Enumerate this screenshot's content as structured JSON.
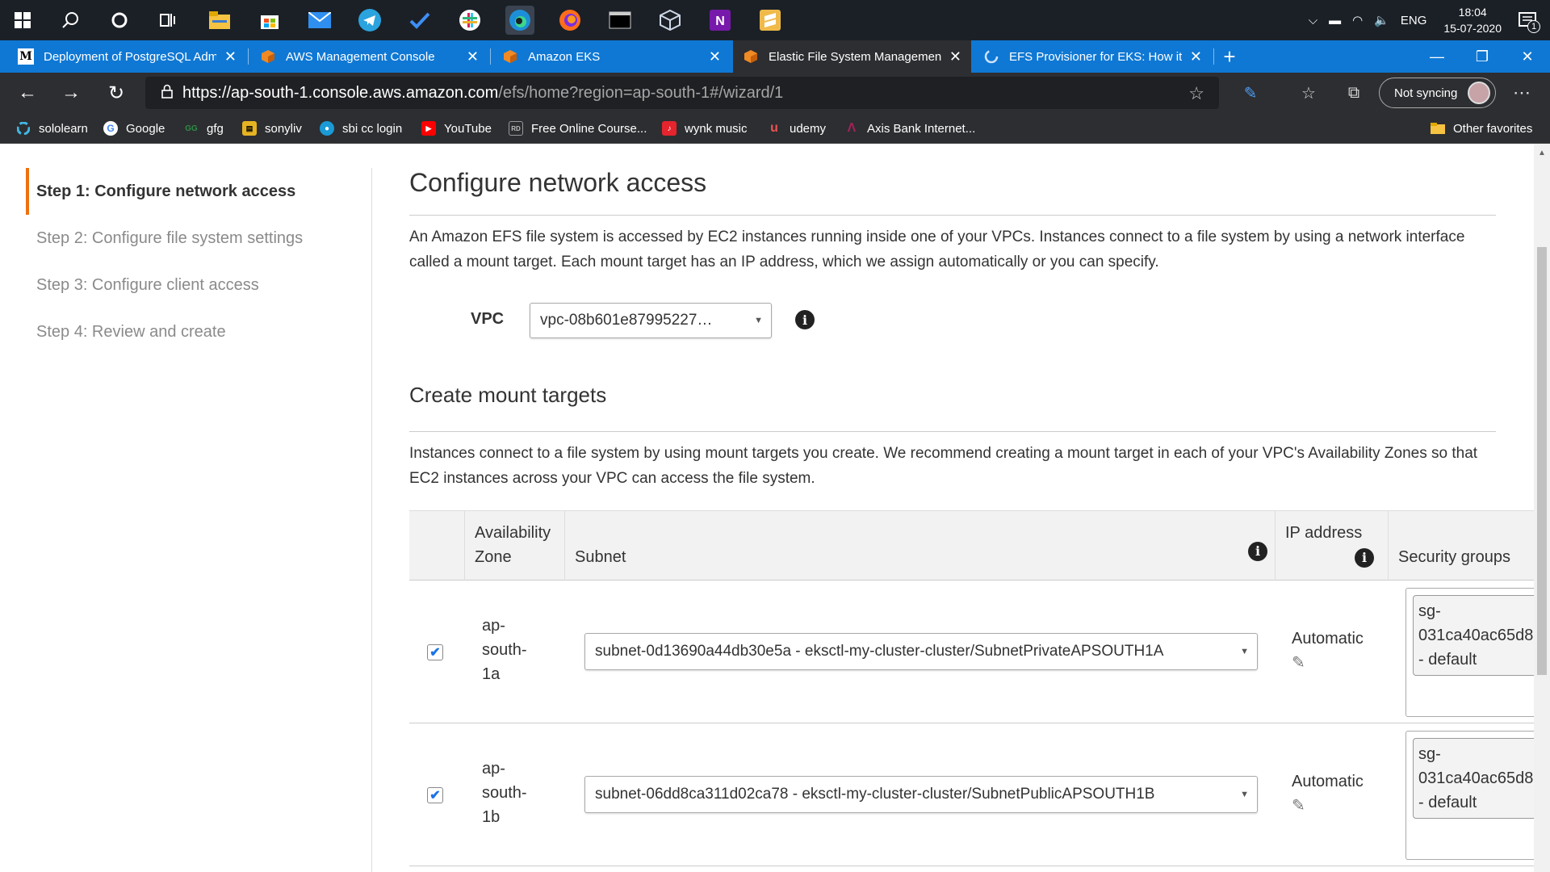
{
  "taskbar": {
    "icons": [
      "windows-start-icon",
      "search-icon",
      "cortana-icon",
      "task-view-icon",
      "file-explorer-icon",
      "store-icon",
      "mail-icon",
      "telegram-icon",
      "todo-icon",
      "slack-icon",
      "edge-icon",
      "firefox-icon",
      "terminal-icon",
      "virtualbox-icon",
      "onenote-icon",
      "sublime-icon"
    ],
    "tray": {
      "language": "ENG",
      "time": "18:04",
      "date": "15-07-2020",
      "notifications": "1"
    }
  },
  "tabs": [
    {
      "title": "Deployment of PostgreSQL Adm",
      "favicon": "M"
    },
    {
      "title": "AWS Management Console",
      "favicon": ""
    },
    {
      "title": "Amazon EKS",
      "favicon": ""
    },
    {
      "title": "Elastic File System Management",
      "favicon": ""
    },
    {
      "title": "EFS Provisioner for EKS: How it W",
      "favicon": ""
    }
  ],
  "address": {
    "host": "https://ap-south-1.console.aws.amazon.com",
    "path": "/efs/home?region=ap-south-1#/wizard/1",
    "sync_label": "Not syncing"
  },
  "favorites": [
    {
      "label": "sololearn"
    },
    {
      "label": "Google"
    },
    {
      "label": "gfg"
    },
    {
      "label": "sonyliv"
    },
    {
      "label": "sbi cc login"
    },
    {
      "label": "YouTube"
    },
    {
      "label": "Free Online Course..."
    },
    {
      "label": "wynk music"
    },
    {
      "label": "udemy"
    },
    {
      "label": "Axis Bank Internet..."
    }
  ],
  "other_favorites": "Other favorites",
  "steps": [
    {
      "label": "Step 1: Configure network access",
      "active": true
    },
    {
      "label": "Step 2: Configure file system settings",
      "active": false
    },
    {
      "label": "Step 3: Configure client access",
      "active": false
    },
    {
      "label": "Step 4: Review and create",
      "active": false
    }
  ],
  "main": {
    "title": "Configure network access",
    "description": "An Amazon EFS file system is accessed by EC2 instances running inside one of your VPCs. Instances connect to a file system by using a network interface called a mount target. Each mount target has an IP address, which we assign automatically or you can specify.",
    "vpc_label": "VPC",
    "vpc_value": "vpc-08b601e87995227…",
    "mount_title": "Create mount targets",
    "mount_description": "Instances connect to a file system by using mount targets you create. We recommend creating a mount target in each of your VPC's Availability Zones so that EC2 instances across your VPC can access the file system."
  },
  "table": {
    "headers": {
      "availability_zone": "Availability Zone",
      "subnet": "Subnet",
      "ip_address": "IP address",
      "security_groups": "Security groups"
    },
    "rows": [
      {
        "checked": true,
        "az": "ap-\nsouth-\n1a",
        "subnet": "subnet-0d13690a44db30e5a - eksctl-my-cluster-cluster/SubnetPrivateAPSOUTH1A",
        "ip": "Automatic",
        "sg": "sg-\n031ca40ac65d8\n- default"
      },
      {
        "checked": true,
        "az": "ap-\nsouth-\n1b",
        "subnet": "subnet-06dd8ca311d02ca78 - eksctl-my-cluster-cluster/SubnetPublicAPSOUTH1B",
        "ip": "Automatic",
        "sg": "sg-\n031ca40ac65d8\n- default"
      }
    ]
  }
}
